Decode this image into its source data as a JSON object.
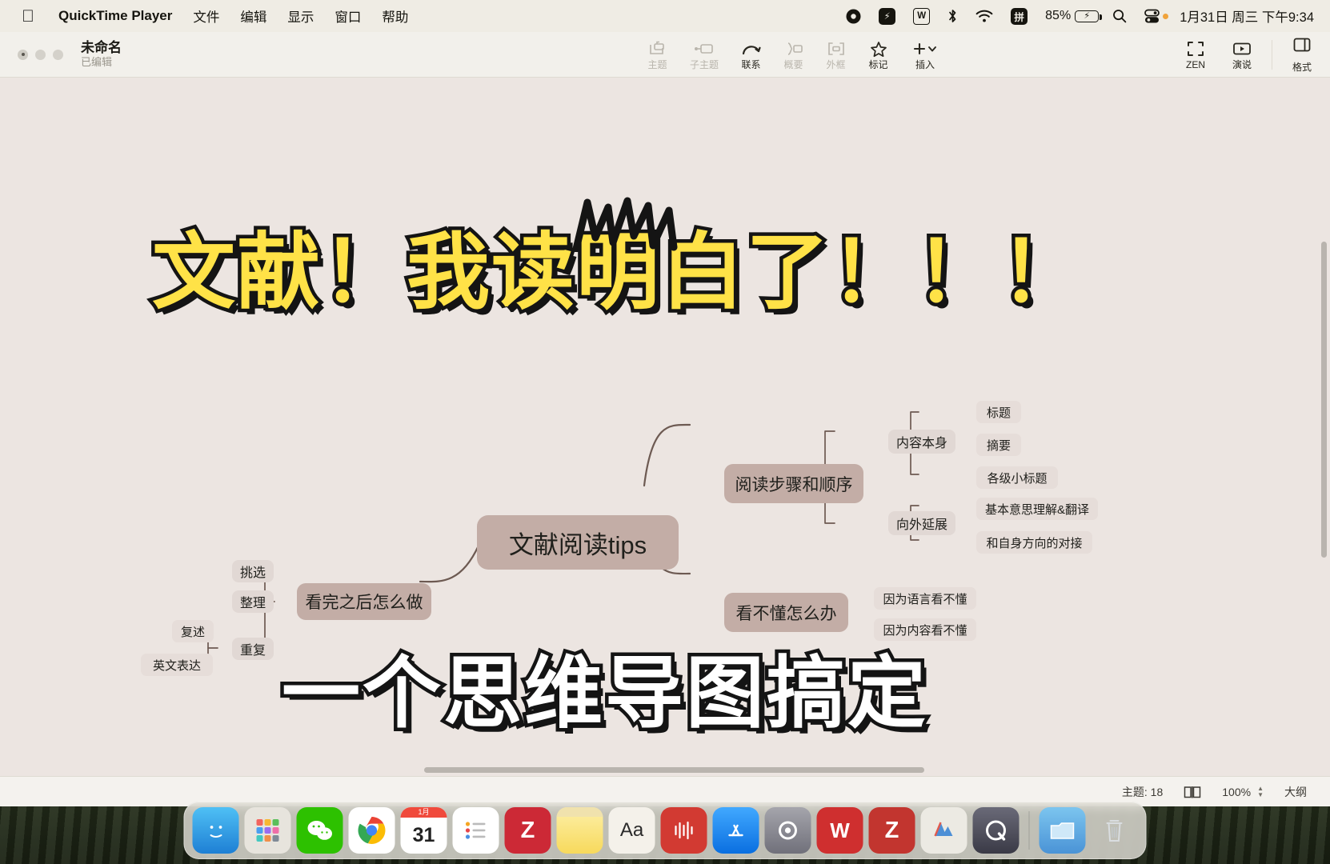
{
  "menubar": {
    "apple_icon": "apple-logo",
    "app_name": "QuickTime Player",
    "items": [
      "文件",
      "编辑",
      "显示",
      "窗口",
      "帮助"
    ],
    "tray": {
      "record_icon": "record-icon",
      "bolt_icon": "bolt-badge-icon",
      "youdao_icon": "W",
      "bluetooth_icon": "bluetooth-icon",
      "wifi_icon": "wifi-icon",
      "input_method": "拼",
      "battery_percent": "85%",
      "battery_icon": "battery-charging-icon",
      "search_icon": "spotlight-search-icon",
      "control_center_icon": "control-center-icon",
      "datetime": "1月31日 周三 下午9:34"
    }
  },
  "window": {
    "traffic_lights": [
      "close",
      "minimize",
      "zoom"
    ],
    "doc_title": "未命名",
    "doc_status": "已编辑",
    "toolbar": [
      {
        "label": "主题",
        "icon": "topic-icon",
        "enabled": false
      },
      {
        "label": "子主题",
        "icon": "subtopic-icon",
        "enabled": false
      },
      {
        "label": "联系",
        "icon": "relation-icon",
        "enabled": true
      },
      {
        "label": "概要",
        "icon": "summary-icon",
        "enabled": false
      },
      {
        "label": "外框",
        "icon": "boundary-icon",
        "enabled": false
      },
      {
        "label": "标记",
        "icon": "marker-star-icon",
        "enabled": true
      },
      {
        "label": "插入",
        "icon": "insert-plus-icon",
        "enabled": true
      }
    ],
    "toolbar_right": [
      {
        "label": "ZEN",
        "icon": "zen-mode-icon"
      },
      {
        "label": "演说",
        "icon": "presentation-icon"
      }
    ],
    "format_button": {
      "label": "格式",
      "icon": "format-panel-icon"
    },
    "statusbar": {
      "topic_count": "主题: 18",
      "view_icon": "outline-view-icon",
      "zoom": "100%",
      "outline_label": "大纲"
    }
  },
  "canvas": {
    "headline_top": "文献！我读明白了！！！",
    "headline_bottom": "一个思维导图搞定",
    "background_color": "#ece5e1",
    "node_main_color": "#c3ada6",
    "node_sub_color": "#e1d8d4"
  },
  "chart_data": {
    "type": "diagram",
    "title": "文献阅读tips",
    "root": "文献阅读tips",
    "branches": [
      {
        "label": "阅读步骤和顺序",
        "side": "right",
        "children": [
          {
            "label": "内容本身",
            "children": [
              {
                "label": "标题"
              },
              {
                "label": "摘要"
              },
              {
                "label": "各级小标题"
              }
            ]
          },
          {
            "label": "向外延展",
            "children": [
              {
                "label": "基本意思理解&翻译"
              },
              {
                "label": "和自身方向的对接"
              }
            ]
          }
        ]
      },
      {
        "label": "看不懂怎么办",
        "side": "right",
        "children": [
          {
            "label": "因为语言看不懂"
          },
          {
            "label": "因为内容看不懂"
          }
        ]
      },
      {
        "label": "看完之后怎么做",
        "side": "left",
        "children": [
          {
            "label": "挑选"
          },
          {
            "label": "整理"
          },
          {
            "label": "重复",
            "children": [
              {
                "label": "复述"
              },
              {
                "label": "英文表达"
              }
            ]
          }
        ]
      }
    ]
  },
  "dock": {
    "items": [
      {
        "name": "finder",
        "label": "",
        "color": "#35a3e8"
      },
      {
        "name": "launchpad",
        "label": "",
        "color": "#d8d4cd"
      },
      {
        "name": "wechat",
        "label": "",
        "color": "#2dc100"
      },
      {
        "name": "chrome",
        "label": "",
        "color": "#ffffff"
      },
      {
        "name": "calendar",
        "label": "31",
        "color": "#ffffff"
      },
      {
        "name": "reminders",
        "label": "",
        "color": "#ffffff"
      },
      {
        "name": "zotero",
        "label": "Z",
        "color": "#cc2936"
      },
      {
        "name": "notes",
        "label": "",
        "color": "#fddf6d"
      },
      {
        "name": "dictionary",
        "label": "Aa",
        "color": "#f2efe8"
      },
      {
        "name": "logic-pro",
        "label": "",
        "color": "#d23a32"
      },
      {
        "name": "app-store",
        "label": "A",
        "color": "#1e8fff"
      },
      {
        "name": "system-settings",
        "label": "",
        "color": "#8c8c93"
      },
      {
        "name": "wps-office",
        "label": "W",
        "color": "#cf2f2f"
      },
      {
        "name": "zotero-alt",
        "label": "Z",
        "color": "#c2352f"
      },
      {
        "name": "snipaste",
        "label": "",
        "color": "#4d8fd6"
      },
      {
        "name": "quicktime",
        "label": "Q",
        "color": "#4a4a55"
      },
      {
        "name": "downloads",
        "label": "",
        "color": "#5ba8e0"
      },
      {
        "name": "trash",
        "label": "",
        "color": "#cfd4d8"
      }
    ]
  }
}
